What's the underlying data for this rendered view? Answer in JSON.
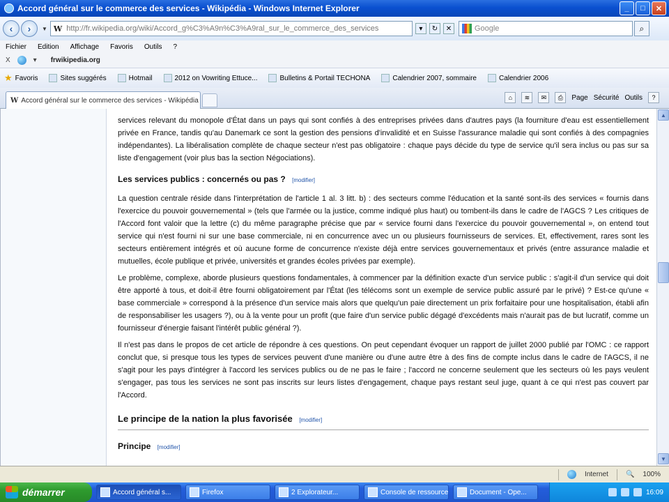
{
  "window": {
    "title": "Accord général sur le commerce des services - Wikipédia - Windows Internet Explorer",
    "buttons": {
      "minimize": "_",
      "maximize": "□",
      "close": "✕"
    }
  },
  "address": {
    "url": "http://fr.wikipedia.org/wiki/Accord_g%C3%A9n%C3%A9ral_sur_le_commerce_des_services",
    "search_placeholder": "Google"
  },
  "menu": [
    "Fichier",
    "Edition",
    "Affichage",
    "Favoris",
    "Outils",
    "?"
  ],
  "extrabar": {
    "prefix": "X",
    "brand": "frwikipedia.org"
  },
  "favorites": [
    {
      "label": "Favoris"
    },
    {
      "label": "Sites suggérés"
    },
    {
      "label": "Hotmail"
    },
    {
      "label": "2012 on Vowriting Ettuce..."
    },
    {
      "label": "Bulletins & Portail TECHONA"
    },
    {
      "label": "Calendrier 2007, sommaire"
    },
    {
      "label": "Calendrier 2006"
    }
  ],
  "tab": {
    "label": "Accord général sur le commerce des services - Wikipédia"
  },
  "commands": {
    "page": "Page",
    "security": "Sécurité",
    "tools": "Outils",
    "help": "?"
  },
  "article": {
    "p0": "services relevant du monopole d'État dans un pays qui sont confiés à des entreprises privées dans d'autres pays (la fourniture d'eau est essentiellement privée en France, tandis qu'au Danemark ce sont la gestion des pensions d'invalidité et en Suisse l'assurance maladie qui sont confiés à des compagnies indépendantes). La libéralisation complète de chaque secteur n'est pas obligatoire : chaque pays décide du type de service qu'il sera inclus ou pas sur sa liste d'engagement (voir plus bas la section Négociations).",
    "h_services": "Les services publics : concernés ou pas ?",
    "edit_label": "[modifier]",
    "p1": "La question centrale réside dans l'interprétation de l'article 1 al. 3 litt. b) : des secteurs comme l'éducation et la santé sont-ils des services « fournis dans l'exercice du pouvoir gouvernemental » (tels que l'armée ou la justice, comme indiqué plus haut) ou tombent-ils dans le cadre de l'AGCS ? Les critiques de l'Accord font valoir que la lettre (c) du même paragraphe précise que par « service fourni dans l'exercice du pouvoir gouvernemental », on entend tout service qui n'est fourni ni sur une base commerciale, ni en concurrence avec un ou plusieurs fournisseurs de services. Et, effectivement, rares sont les secteurs entièrement intégrés et où aucune forme de concurrence n'existe déjà entre services gouvernementaux et privés (entre assurance maladie et mutuelles, école publique et privée, universités et grandes écoles privées par exemple).",
    "p2": "Le problème, complexe, aborde plusieurs questions fondamentales, à commencer par la définition exacte d'un service public : s'agit-il d'un service qui doit être apporté à tous, et doit-il être fourni obligatoirement par l'État (les télécoms sont un exemple de service public assuré par le privé) ? Est-ce qu'une « base commerciale » correspond à la présence d'un service mais alors que quelqu'un paie directement un prix forfaitaire pour une hospitalisation, établi afin de responsabiliser les usagers ?), ou à la vente pour un profit (que faire d'un service public dégagé d'excédents mais n'aurait pas de but lucratif, comme un fournisseur d'énergie faisant l'intérêt public général ?).",
    "p3": "Il n'est pas dans le propos de cet article de répondre à ces questions. On peut cependant évoquer un rapport de juillet 2000 publié par l'OMC : ce rapport conclut que, si presque tous les types de services peuvent d'une manière ou d'une autre être à des fins de compte inclus dans le cadre de l'AGCS, il ne s'agit pour les pays d'intégrer à l'accord les services publics ou de ne pas le faire ; l'accord ne concerne seulement que les secteurs où les pays veulent s'engager, pas tous les services ne sont pas inscrits sur leurs listes d'engagement, chaque pays restant seul juge, quant à ce qui n'est pas couvert par l'Accord.",
    "h_nation": "Le principe de la nation la plus favorisée",
    "h_principe": "Principe"
  },
  "status": {
    "zone": "Internet",
    "zoom": "100%"
  },
  "taskbar": {
    "start": "démarrer",
    "tasks": [
      "Accord général s...",
      "Firefox",
      "2 Explorateur...",
      "Console de ressources",
      "Document - Ope..."
    ],
    "clock": "16:09"
  }
}
